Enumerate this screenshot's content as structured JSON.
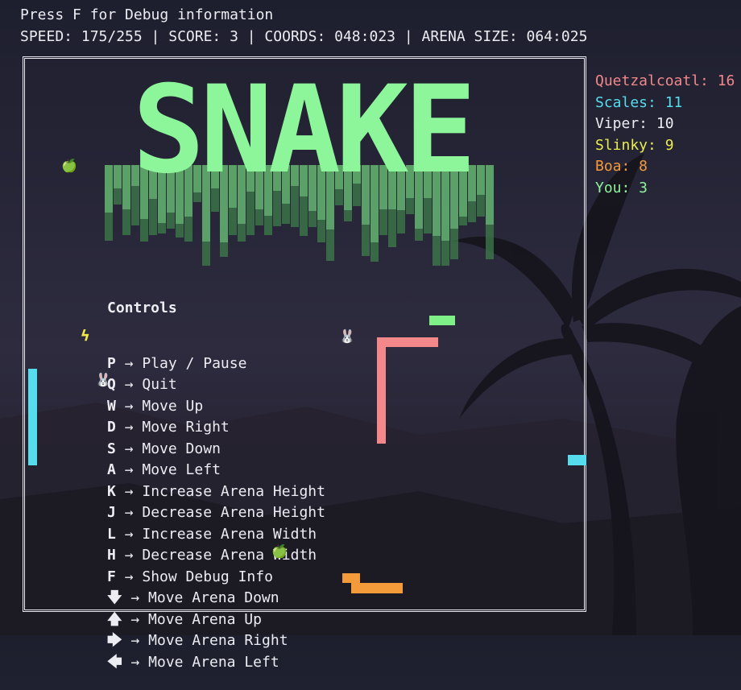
{
  "hud": {
    "line1": "Press F for Debug information",
    "line2": "SPEED: 175/255 | SCORE: 3 | COORDS: 048:023 | ARENA SIZE: 064:025"
  },
  "title": "SNAKE",
  "colors": {
    "logo_light": "#8df59a",
    "logo_mid": "#6cc978",
    "logo_dark": "#3e7d4b",
    "arena_border": "#e8e8ee",
    "snake_pink": "#f2888a",
    "snake_cyan": "#55dded",
    "snake_orange": "#f39a3b",
    "snake_green": "#7ff088"
  },
  "leaderboard": [
    {
      "name": "Quetzalcoatl",
      "score": "16",
      "text": "Quetzalcoatl: 16",
      "color": "#f2888a"
    },
    {
      "name": "Scales",
      "score": "11",
      "text": "Scales: 11",
      "color": "#55dded"
    },
    {
      "name": "Viper",
      "score": "10",
      "text": "Viper: 10",
      "color": "#ececf2"
    },
    {
      "name": "Slinky",
      "score": "9",
      "text": "Slinky: 9",
      "color": "#e9ed4d"
    },
    {
      "name": "Boa",
      "score": "8",
      "text": "Boa: 8",
      "color": "#f39a3b"
    },
    {
      "name": "You",
      "score": "3",
      "text": "You: 3",
      "color": "#8df59a"
    }
  ],
  "controls": {
    "title": "Controls",
    "arrow": "→",
    "items": [
      {
        "key": "P",
        "action": "Play / Pause"
      },
      {
        "key": "Q",
        "action": "Quit"
      },
      {
        "key": "W",
        "action": "Move Up"
      },
      {
        "key": "D",
        "action": "Move Right"
      },
      {
        "key": "S",
        "action": "Move Down"
      },
      {
        "key": "A",
        "action": "Move Left"
      },
      {
        "key": "K",
        "action": "Increase Arena Height"
      },
      {
        "key": "J",
        "action": "Decrease Arena Height"
      },
      {
        "key": "L",
        "action": "Increase Arena Width"
      },
      {
        "key": "H",
        "action": "Decrease Arena Width"
      },
      {
        "key": "F",
        "action": "Show Debug Info"
      },
      {
        "key": "🡇",
        "action": "Move Arena Down"
      },
      {
        "key": "🡅",
        "action": "Move Arena Up"
      },
      {
        "key": "🡆",
        "action": "Move Arena Right"
      },
      {
        "key": "🡄",
        "action": "Move Arena Left"
      }
    ]
  },
  "pickups": {
    "apple": "🍏",
    "bunny": "🐰",
    "bolt": "ϟ"
  }
}
